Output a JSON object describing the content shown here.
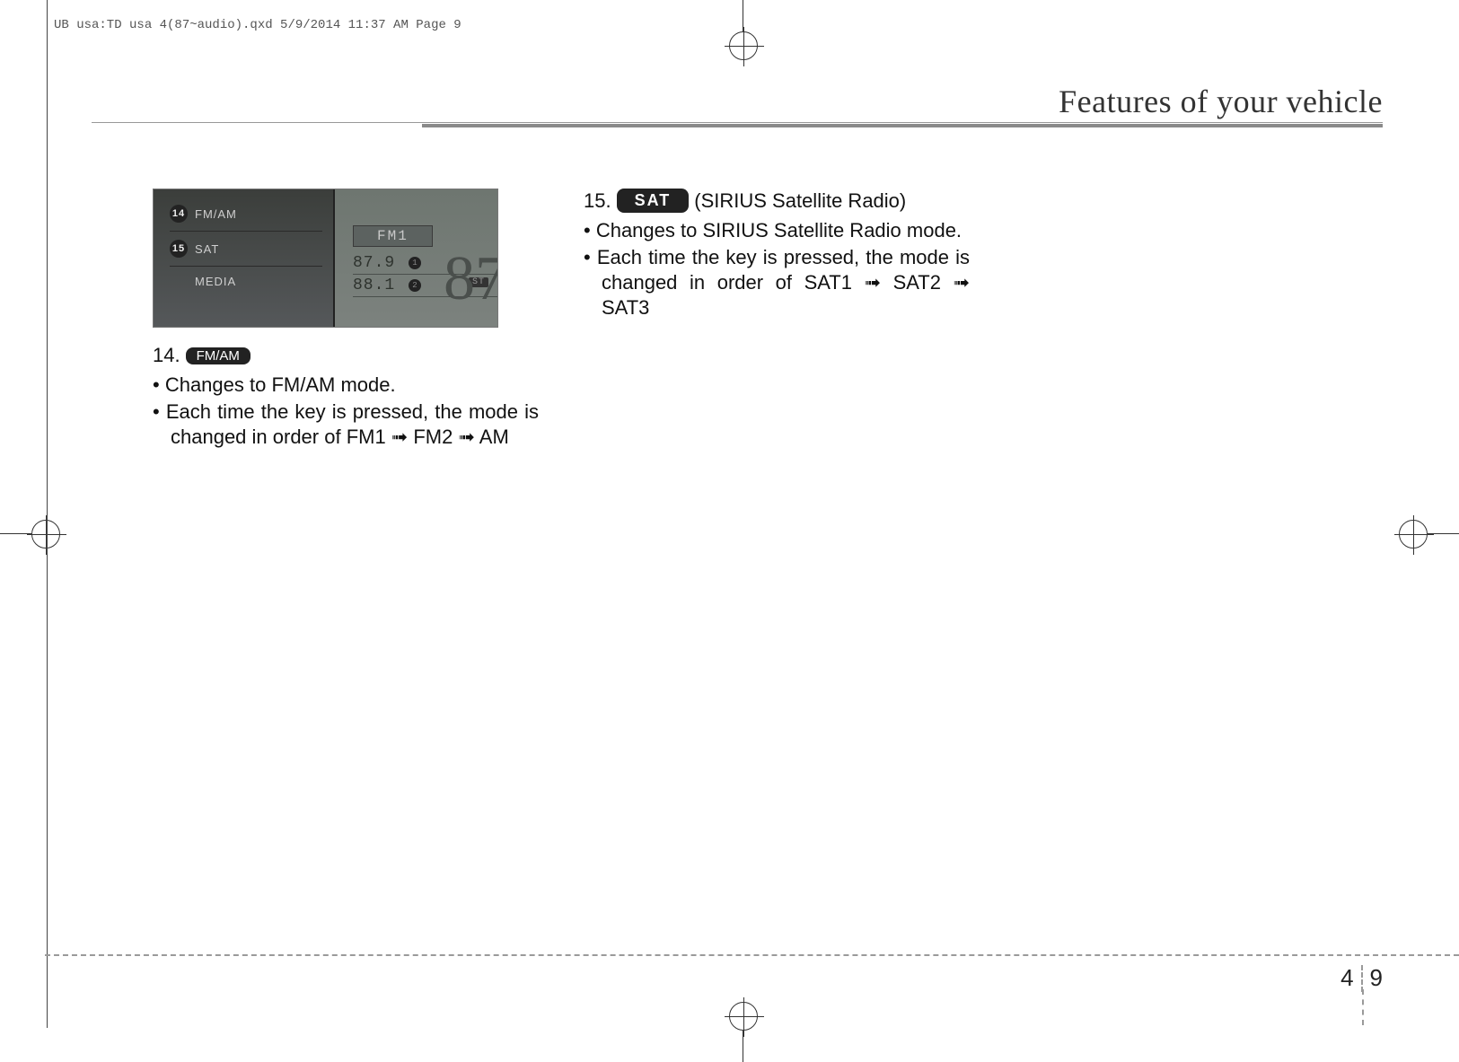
{
  "print_header": "UB usa:TD usa 4(87~audio).qxd  5/9/2014  11:37 AM  Page 9",
  "section_title": "Features of your vehicle",
  "figure": {
    "callouts": [
      {
        "num": "14",
        "label": "FM/AM"
      },
      {
        "num": "15",
        "label": "SAT"
      }
    ],
    "third_label": "MEDIA",
    "band": "FM1",
    "st_badge": "ST",
    "presets": [
      {
        "freq": "87.9",
        "slot": "1"
      },
      {
        "freq": "88.1",
        "slot": "2"
      }
    ],
    "big_freq_partial": "87"
  },
  "item14": {
    "number": "14.",
    "key": "FM/AM",
    "bullets": [
      "Changes to FM/AM mode.",
      "Each time the key is pressed, the mode is changed in order of FM1 ➟ FM2 ➟ AM"
    ]
  },
  "item15": {
    "number": "15.",
    "key": "SAT",
    "suffix": "(SIRIUS Satellite Radio)",
    "bullets": [
      "Changes to SIRIUS Satellite Radio mode.",
      "Each time the key is pressed, the mode is changed in order of SAT1 ➟ SAT2 ➟ SAT3"
    ]
  },
  "page_number": {
    "chapter": "4",
    "page": "9"
  }
}
